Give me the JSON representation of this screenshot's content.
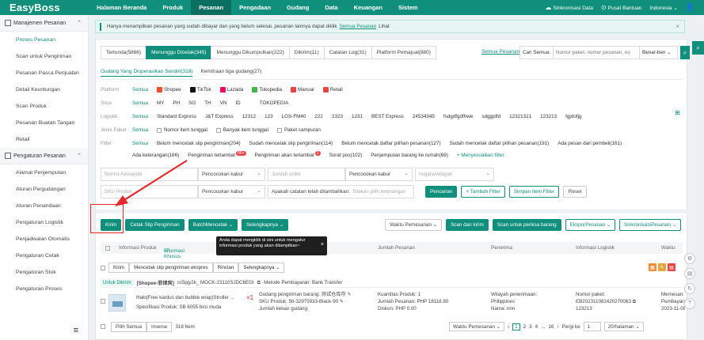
{
  "brand": {
    "logo": "EasyBoss",
    "logo_suffix": "",
    "accent": "#0f8f7c",
    "red": "#e42a2a"
  },
  "nav": {
    "items": [
      "Halaman Beranda",
      "Produk",
      "Pesanan",
      "Pengadaan",
      "Gudang",
      "Data",
      "Keuangan",
      "Sistem"
    ],
    "active": "Pesanan",
    "sync": "Sinkronisasi Data",
    "help": "Pusat Bantuan",
    "lang": "Indonesia"
  },
  "sidebar": {
    "group1": "Manajemen Pesanan",
    "items1": [
      "Proses Pesanan",
      "Scan untuk Pengiriman",
      "Pesanan Pasca Penjualan",
      "Detail Keuntungan",
      "Scan Produk",
      "Pesanan Buatan Tangan",
      "Retail"
    ],
    "group2": "Pengaturan Pesanan",
    "items2": [
      "Alamat Penjemputan",
      "Aturan Pergudangan",
      "Aturan Penandaan",
      "Pengaturan Logistik",
      "Penjadwalan Otomatis",
      "Pengaturan Cetak",
      "Pengaturan Stok",
      "Pengaturan Proses"
    ]
  },
  "banner": {
    "pre": "Hanya menampilkan pesanan yang sudah dibayar dan yang belum selesai, pesanan lainnya dapat diklik",
    "link": "Semua Pesanan",
    "post": "Lihat"
  },
  "tabs": [
    "Tertunda(5866)",
    "Menunggu Dicetak(345)",
    "Menunggu Dikumpulkan(222)",
    "Dikirim(11)",
    "Catatan Log(31)",
    "Platform Pemajual(880)"
  ],
  "all_orders_link": "Semua Pesanan",
  "search": {
    "label": "Cari Semua:",
    "placeholder": "Nomor paket, nomor pesanan, no",
    "mode": "Benar-ben"
  },
  "subtabs": [
    "Gudang Yang Dioperasikan Sendiri(318)",
    "Kemitraan tiga gudang(27)"
  ],
  "filters": {
    "platform": {
      "label": "Platform",
      "all": "Semua",
      "opts": [
        "Shopee",
        "TikTok",
        "Lazada",
        "Tokopedia",
        "Manual",
        "Retail"
      ]
    },
    "situs": {
      "label": "Situs",
      "all": "Semua",
      "opts": [
        "MY",
        "PH",
        "SG",
        "TH",
        "VN",
        "ID",
        "TOKOPEDIA"
      ]
    },
    "logistik": {
      "label": "Logistik",
      "all": "Semua",
      "opts": [
        "Standard Express",
        "J&T Express",
        "12312",
        "123",
        "LGS-FM40",
        "222",
        "2323",
        "1231",
        "BEST Express",
        "24534345",
        "fsdgdfgdfhwe",
        "sdgjgdfd",
        "12321321",
        "123213",
        "fgjdofjg"
      ]
    },
    "jenis": {
      "label": "Jenis Paket",
      "all": "Semua",
      "opts": [
        "Nomor item tunggal",
        "Banyak item tunggal",
        "Paket campuran"
      ]
    },
    "filter": {
      "label": "Filter",
      "all": "Semua",
      "opts": [
        "Belum mencetak slip pengiriman(204)",
        "Sudah mencetak slip pengiriman(114)",
        "Belum mencetak daftar pilihan pesanan(127)",
        "Sudah mencetak daftar pilihan pesanan(191)",
        "Ada pesan dari pembeli(161)"
      ],
      "opts2": [
        "Ada keterangan(166)",
        "Pengiriman terlambat",
        "Pengiriman akan terlambat",
        "Surat pos(102)",
        "Penjemputan barang ke rumah(69)"
      ],
      "badge_late": "99+",
      "badge_soon": "1",
      "custom": "+ Menyesuaikan filter"
    }
  },
  "inputs": {
    "airwaybill": "Nomor Airwaybill",
    "match1": "Pencocokan kabur",
    "order": "Jumlah order",
    "match2": "Pencocokan kabur",
    "region": "negara/wilayah",
    "sku": "SKU Produk",
    "match3": "Pencocokan kabur",
    "note_q": "Apakah catatan telah ditambahkan:",
    "note_ph": "Silakan pilih keterangan",
    "btn_search": "Pencarian",
    "btn_add_filter": "+ Tambah Filter",
    "btn_save_filter": "Simpan Item Filter",
    "btn_reset": "Reset"
  },
  "actions": {
    "kirim": "Kirim",
    "cetak": "Cetak Slip Pengiriman",
    "batch": "BatchMencetak",
    "more": "Selengkapnya",
    "time": "Waktu Pemesanan",
    "scan_send": "Scan dan kirim",
    "scan_check": "Scan untuk periksa barang",
    "export": "EksporPesanan",
    "sync": "SinkronisasiPesanan"
  },
  "table": {
    "cols": [
      "Informasi Produk",
      "Informasi Khusus",
      "Jumlah Pesanan",
      "Penerima",
      "Informasi Logistik",
      "Waktu"
    ],
    "tooltip": "Anda dapat mengklik di sini untuk mengatur informasi produk yang akan ditampilkan~"
  },
  "subactions": [
    "Kirim",
    "Mencetak slip pengiriman ekspres",
    "Rincian",
    "Selengkapnya"
  ],
  "order": {
    "status": "Untuk Dikirim",
    "shop": "[Shopee-菲律宾]",
    "ids": "cc5pjy2k_   MOCK-23110SJDC6EGI",
    "payment": "Metode Pembayaran: Bank Transfer",
    "product_name": "Halo(Free kardus dan bubble wrap)Stroller ...",
    "qty_mark": "×1",
    "spec": "Spesifikasi Produk: SB 6055 biru muda",
    "warehouse": "Gudang pengiriman barang:",
    "warehouse_val": "测试仓库存",
    "sku": "SKU Produk:",
    "sku_val": "5tt-32975933-Black-90",
    "stock_out": "Jumlah keluar gudang:",
    "qty_label": "Kuantitas Produk:",
    "qty_val": "1",
    "amount_label": "Jumlah Pesanan:",
    "amount_val": "PHP 18118.80",
    "discount_label": "Diskon:",
    "discount_val": "PHP 0.00",
    "region_label": "Wilayah penerimaan:",
    "region_val": "Philippines",
    "name_label": "Nama:",
    "name_val": "nnn",
    "pkg_label": "Nomor paket:",
    "pkg_val": "EB20231108142027006З",
    "pkg_val2": "123213",
    "time_label": "Memesan:",
    "time_label2": "Pembayaran:",
    "time_val": "2023-11-08"
  },
  "footer": {
    "select_all": "Pilih Semua",
    "inverse": "Inverse",
    "count": "318 Item",
    "sort": "Waktu Pemesanan",
    "pages": [
      "1",
      "2",
      "3",
      "4",
      "...",
      "16"
    ],
    "goto": "Pergi ke",
    "goto_val": "1",
    "per_page": "20/halaman"
  }
}
